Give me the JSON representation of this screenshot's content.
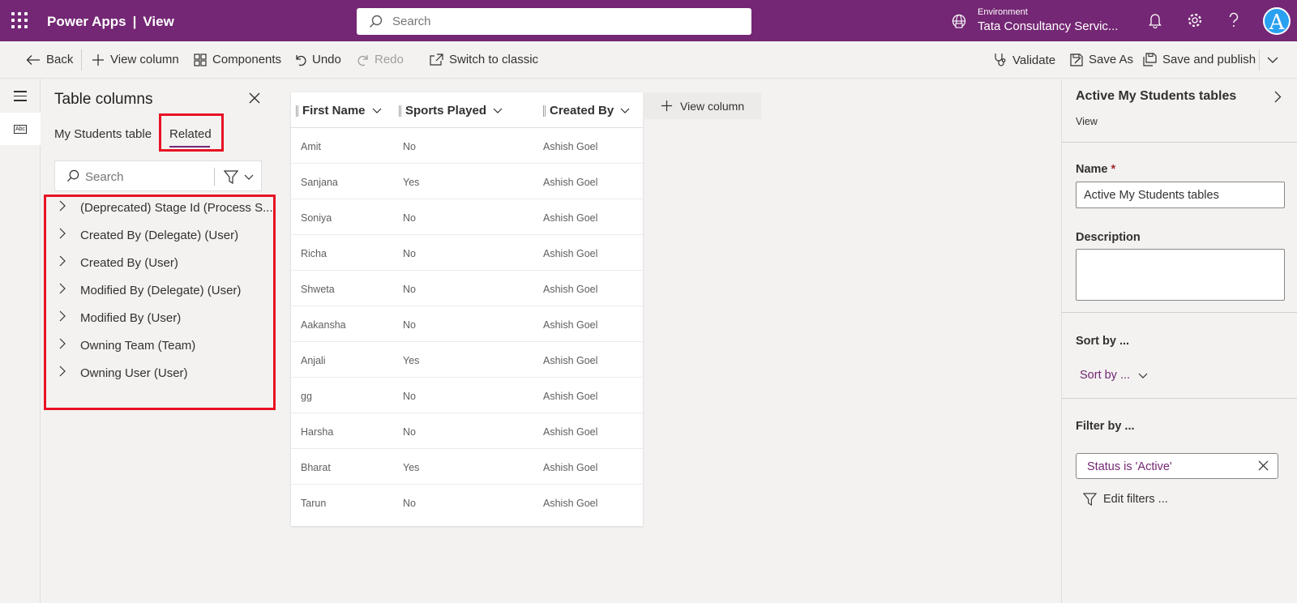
{
  "topbar": {
    "app_name": "Power Apps",
    "separator": "|",
    "page_name": "View",
    "search_placeholder": "Search",
    "environment_label": "Environment",
    "environment_name": "Tata Consultancy Servic...",
    "avatar_initial": "A"
  },
  "commands": {
    "back": "Back",
    "view_column": "View column",
    "components": "Components",
    "undo": "Undo",
    "redo": "Redo",
    "switch_classic": "Switch to classic",
    "validate": "Validate",
    "save_as": "Save As",
    "save_publish": "Save and publish"
  },
  "rail": {
    "abc_label": "Abc"
  },
  "columns_panel": {
    "title": "Table columns",
    "tabs": [
      "My Students table",
      "Related"
    ],
    "active_tab": "Related",
    "search_placeholder": "Search",
    "related_items": [
      "(Deprecated) Stage Id (Process S...",
      "Created By (Delegate) (User)",
      "Created By (User)",
      "Modified By (Delegate) (User)",
      "Modified By (User)",
      "Owning Team (Team)",
      "Owning User (User)"
    ]
  },
  "grid": {
    "columns": [
      "First Name",
      "Sports Played",
      "Created By"
    ],
    "rows": [
      [
        "Amit",
        "No",
        "Ashish Goel"
      ],
      [
        "Sanjana",
        "Yes",
        "Ashish Goel"
      ],
      [
        "Soniya",
        "No",
        "Ashish Goel"
      ],
      [
        "Richa",
        "No",
        "Ashish Goel"
      ],
      [
        "Shweta",
        "No",
        "Ashish Goel"
      ],
      [
        "Aakansha",
        "No",
        "Ashish Goel"
      ],
      [
        "Anjali",
        "Yes",
        "Ashish Goel"
      ],
      [
        "gg",
        "No",
        "Ashish Goel"
      ],
      [
        "Harsha",
        "No",
        "Ashish Goel"
      ],
      [
        "Bharat",
        "Yes",
        "Ashish Goel"
      ],
      [
        "Tarun",
        "No",
        "Ashish Goel"
      ]
    ],
    "add_column_label": "View column"
  },
  "properties": {
    "title": "Active My Students tables",
    "subtitle": "View",
    "name_label": "Name",
    "required_mark": "*",
    "name_value": "Active My Students tables",
    "description_label": "Description",
    "description_value": "",
    "sort_heading": "Sort by ...",
    "sort_dropdown": "Sort by ...",
    "filter_heading": "Filter by ...",
    "filter_condition": "Status is 'Active'",
    "edit_filters": "Edit filters ..."
  },
  "colors": {
    "brand": "#742774",
    "highlight": "#e81123"
  }
}
